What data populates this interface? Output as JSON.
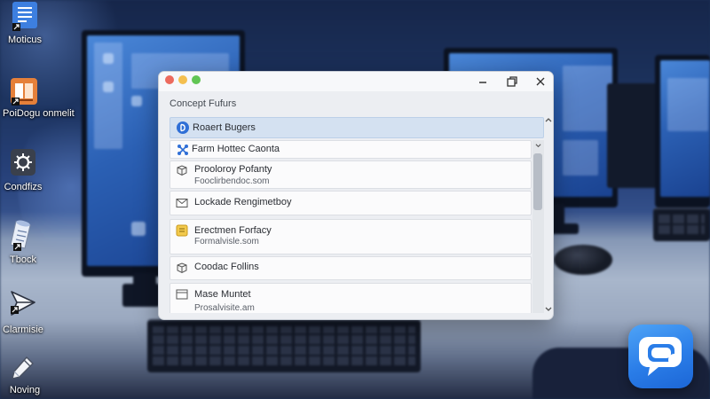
{
  "desktop": {
    "icons": [
      {
        "label": "Moticus",
        "icon": "document-icon"
      },
      {
        "label": "PoiDogu onmelit",
        "icon": "presentation-icon"
      },
      {
        "label": "Condfizs",
        "icon": "settings-icon"
      },
      {
        "label": "Tbock",
        "icon": "scroll-icon"
      },
      {
        "label": "Clarmisie",
        "icon": "send-icon"
      },
      {
        "label": "Noving",
        "icon": "pen-icon"
      }
    ]
  },
  "window": {
    "section_title": "Concept Fufurs",
    "controls": {
      "minimize": "minimize-icon",
      "restore": "restore-icon",
      "close": "close-icon"
    },
    "items": [
      {
        "title": "Roaert Bugers",
        "icon": "user-circle-icon",
        "selected": true
      },
      {
        "title": "Farm Hottec Caonta",
        "icon": "network-icon"
      },
      {
        "title": "Prooloroy Pofanty",
        "subtitle": "Fooclirbendoc.som",
        "icon": "box-icon"
      },
      {
        "title": "Lockade Rengimetboy",
        "icon": "mail-icon"
      },
      {
        "title": "Erectmen Forfacy",
        "subtitle": "Formalvisle.som",
        "icon": "note-icon"
      },
      {
        "title": "Coodac Follins",
        "icon": "package-icon"
      },
      {
        "title": "Mase Muntet",
        "subtitle": "Prosalvisite.am",
        "icon": "window-icon"
      }
    ]
  },
  "dock_app": {
    "icon": "chat-bubble-icon"
  },
  "colors": {
    "accent": "#2f6fd6",
    "selection": "#d4e1f1",
    "traffic_red": "#ec6a5e",
    "traffic_yellow": "#f4bf4f",
    "traffic_green": "#61c554",
    "app_icon": "#2a7de8",
    "wallpaper": "#1d3460"
  }
}
